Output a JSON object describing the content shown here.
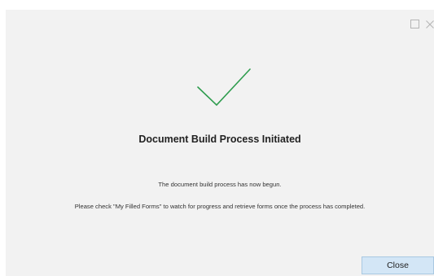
{
  "dialog": {
    "title": "Document Build Process Initiated",
    "message_line1": "The document build process has now begun.",
    "message_line2": "Please check \"My Filled Forms\" to watch for progress and retrieve forms once the process has completed.",
    "close_label": "Close"
  },
  "icons": {
    "success": "checkmark-icon",
    "maximize": "maximize-icon",
    "close": "close-icon"
  },
  "colors": {
    "success": "#2e9c4e",
    "dialog_background": "#f2f2f2",
    "button_background": "#d3e6f6",
    "button_border": "#a9c8e2",
    "window_controls": "#b5b5b5"
  }
}
